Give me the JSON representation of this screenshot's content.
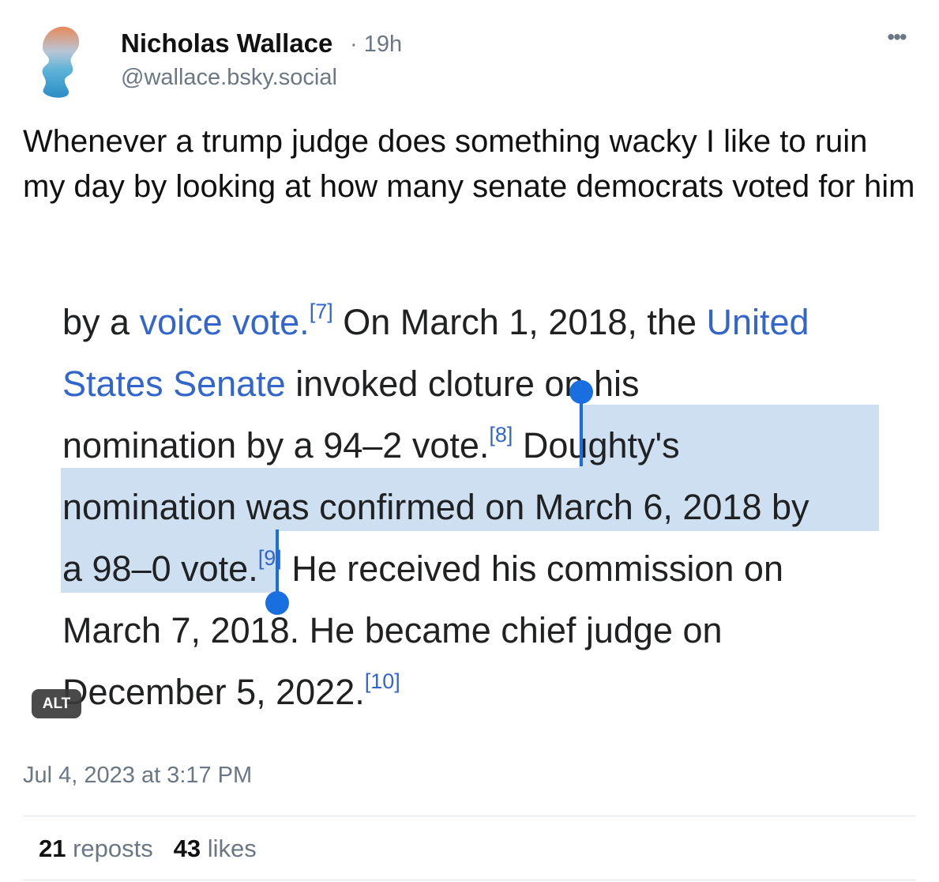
{
  "author": {
    "name": "Nicholas Wallace",
    "separator": "·",
    "time": "19h",
    "handle": "@wallace.bsky.social",
    "avatar_icon": "silhouette-avatar-icon"
  },
  "menu_icon": "more-options-icon",
  "post": {
    "text": "Whenever a trump judge does something wacky I like to ruin my day by looking at how many senate democrats voted for him"
  },
  "embed": {
    "alt_badge": "ALT",
    "lines": [
      {
        "t1": "by a ",
        "link1": "voice vote.",
        "sup1": "[7]",
        "t2": " On March 1, 2018, the ",
        "link2": "United"
      },
      {
        "link1": "States Senate",
        "t1": " invoked cloture on his"
      },
      {
        "t1": "nomination by a 94–2 vote.",
        "sup1": "[8]",
        "t2": " Doughty's"
      },
      {
        "t1": "nomination was confirmed on March 6, 2018 by"
      },
      {
        "t1": "a 98–0 vote.",
        "sup1": "[9]",
        "t2": " He received his commission on"
      },
      {
        "t1": "March 7, 2018. He became chief judge on"
      },
      {
        "t1": "December 5, 2022.",
        "sup1": "[10]"
      }
    ],
    "highlight_color": "#cddff0",
    "link_color": "#3366cc",
    "cursor_color": "#1a6fe0"
  },
  "timestamp": "Jul 4, 2023 at 3:17 PM",
  "stats": {
    "reposts_count": "21",
    "reposts_label": "reposts",
    "likes_count": "43",
    "likes_label": "likes"
  }
}
